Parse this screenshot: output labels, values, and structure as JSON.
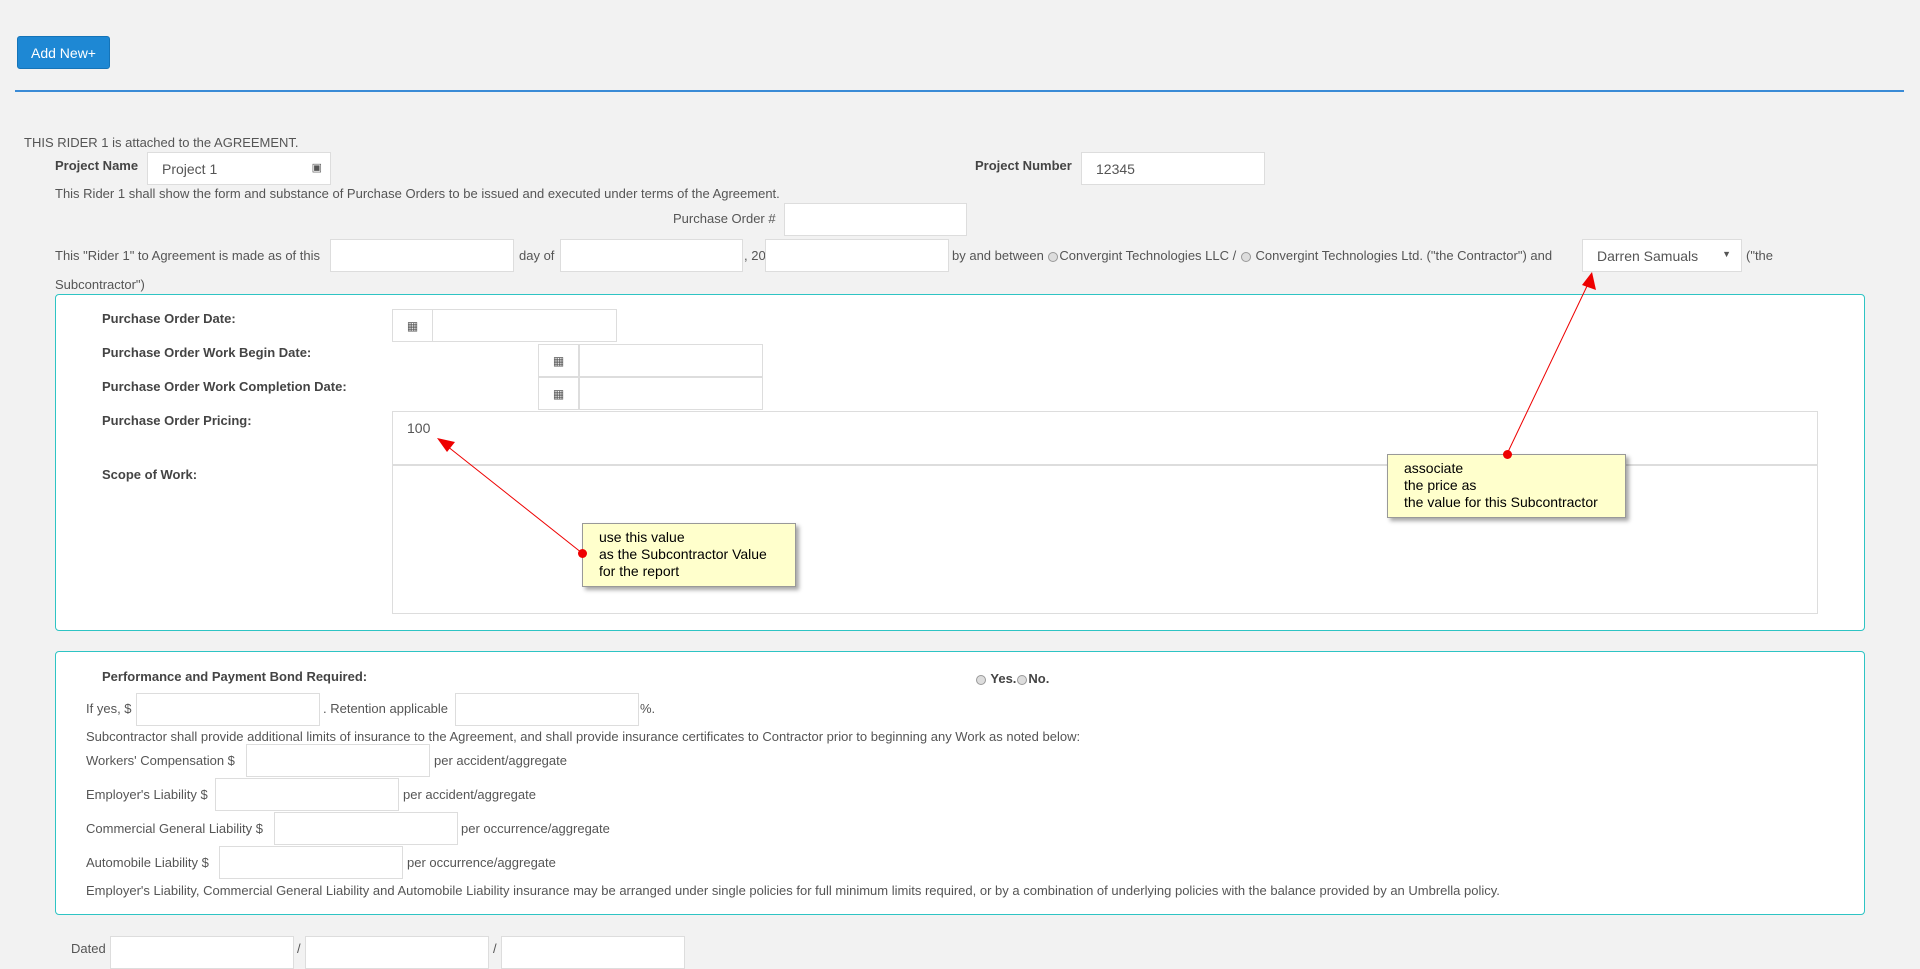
{
  "toolbar": {
    "add_new": "Add New+"
  },
  "header": {
    "attached": "THIS RIDER 1 is attached to the AGREEMENT.",
    "project_name_label": "Project Name",
    "project_name": "Project 1",
    "project_number_label": "Project Number",
    "project_number": "12345",
    "rider_text": "This Rider 1 shall show the form and substance of Purchase Orders to be issued and executed under terms of the Agreement.",
    "po_number_label": "Purchase Order #"
  },
  "agreement": {
    "made_as_of": "This \"Rider 1\" to Agreement is made as of this",
    "day_of": "day of",
    "year_prefix": ", 20",
    "by_between": "by and between",
    "contractor_llc": "Convergint Technologies LLC /",
    "contractor_ltd": "Convergint Technologies Ltd. (\"the Contractor\") and",
    "subcontractor_selected": "Darren Samuals",
    "the": "(\"the",
    "subcontractor": "Subcontractor\")"
  },
  "po": {
    "date_label": "Purchase Order Date:",
    "begin_label": "Purchase Order Work Begin Date:",
    "completion_label": "Purchase Order Work Completion Date:",
    "pricing_label": "Purchase Order Pricing:",
    "pricing_value": "100",
    "scope_label": "Scope of Work:"
  },
  "bond": {
    "label": "Performance and Payment Bond Required:",
    "yes": "Yes.",
    "no": "No.",
    "if_yes": "If yes, $",
    "retention": ". Retention applicable",
    "percent": "%.",
    "insurance_text": "Subcontractor shall provide additional limits of insurance to the Agreement, and shall provide insurance certificates to Contractor prior to beginning any Work as noted below:",
    "workers_label": "Workers' Compensation $",
    "workers_suffix": "per accident/aggregate",
    "employers_label": "Employer's Liability $",
    "employers_suffix": "per accident/aggregate",
    "cgl_label": "Commercial General Liability $",
    "cgl_suffix": "per occurrence/aggregate",
    "auto_label": "Automobile Liability $",
    "auto_suffix": "per occurrence/aggregate",
    "umbrella_text": "Employer's Liability, Commercial General Liability and Automobile Liability insurance may be arranged under single policies for full minimum limits required, or by a combination of underlying policies with the balance provided by an Umbrella policy."
  },
  "footer": {
    "dated": "Dated",
    "sep": "/"
  },
  "notes": {
    "note1": "use this value\nas the Subcontractor Value\nfor the report",
    "note2": "associate\nthe price as\nthe value for this Subcontractor"
  },
  "colors": {
    "accent": "#1e88d4",
    "panel_border": "#2ec4c4",
    "note_bg": "#ffffcc",
    "arrow": "#e00000"
  }
}
